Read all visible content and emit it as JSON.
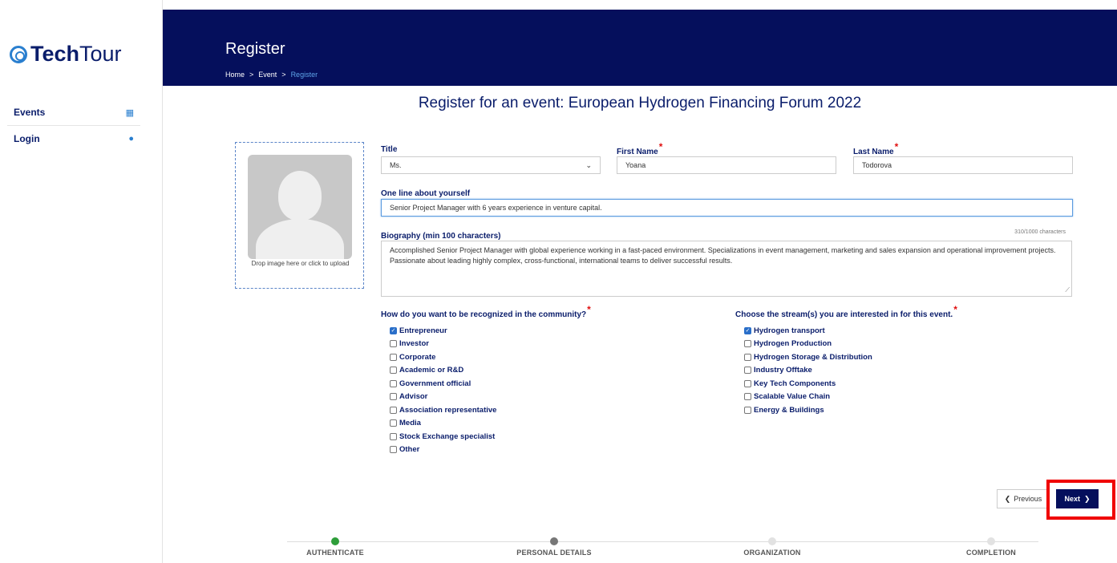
{
  "sidebar": {
    "logo_bold": "Tech",
    "logo_light": "Tour",
    "items": [
      {
        "label": "Events",
        "icon": "calendar-icon"
      },
      {
        "label": "Login",
        "icon": "user-icon"
      }
    ]
  },
  "header": {
    "title": "Register",
    "breadcrumb": [
      {
        "label": "Home"
      },
      {
        "label": "Event"
      },
      {
        "label": "Register"
      }
    ]
  },
  "page_title": "Register for an event: European Hydrogen Financing Forum 2022",
  "upload": {
    "text": "Drop image here or click to upload"
  },
  "form": {
    "title": {
      "label": "Title",
      "value": "Ms."
    },
    "first_name": {
      "label": "First Name",
      "value": "Yoana"
    },
    "last_name": {
      "label": "Last Name",
      "value": "Todorova"
    },
    "one_line": {
      "label": "One line about yourself",
      "value": "Senior Project Manager with 6 years experience in venture capital."
    },
    "biography": {
      "label": "Biography (min 100 characters)",
      "counter": "310/1000 characters",
      "value": "Accomplished Senior Project Manager with global experience working in a fast-paced environment. Specializations in event management, marketing and sales expansion and operational improvement projects. Passionate about leading highly complex, cross-functional, international teams to deliver successful results."
    },
    "recognition": {
      "label": "How do you want to be recognized in the community?",
      "options": [
        {
          "label": "Entrepreneur",
          "checked": true
        },
        {
          "label": "Investor",
          "checked": false
        },
        {
          "label": "Corporate",
          "checked": false
        },
        {
          "label": "Academic or R&D",
          "checked": false
        },
        {
          "label": "Government official",
          "checked": false
        },
        {
          "label": "Advisor",
          "checked": false
        },
        {
          "label": "Association representative",
          "checked": false
        },
        {
          "label": "Media",
          "checked": false
        },
        {
          "label": "Stock Exchange specialist",
          "checked": false
        },
        {
          "label": "Other",
          "checked": false
        }
      ]
    },
    "streams": {
      "label": "Choose the stream(s) you are interested in for this event.",
      "options": [
        {
          "label": "Hydrogen transport",
          "checked": true
        },
        {
          "label": "Hydrogen Production",
          "checked": false
        },
        {
          "label": "Hydrogen Storage & Distribution",
          "checked": false
        },
        {
          "label": "Industry Offtake",
          "checked": false
        },
        {
          "label": "Key Tech Components",
          "checked": false
        },
        {
          "label": "Scalable Value Chain",
          "checked": false
        },
        {
          "label": "Energy & Buildings",
          "checked": false
        }
      ]
    }
  },
  "buttons": {
    "previous": "Previous",
    "next": "Next"
  },
  "steps": [
    {
      "label": "AUTHENTICATE",
      "color": "#2e9e3a"
    },
    {
      "label": "PERSONAL DETAILS",
      "color": "#777777"
    },
    {
      "label": "ORGANIZATION",
      "color": "#e2e2e2"
    },
    {
      "label": "COMPLETION",
      "color": "#e2e2e2"
    }
  ]
}
